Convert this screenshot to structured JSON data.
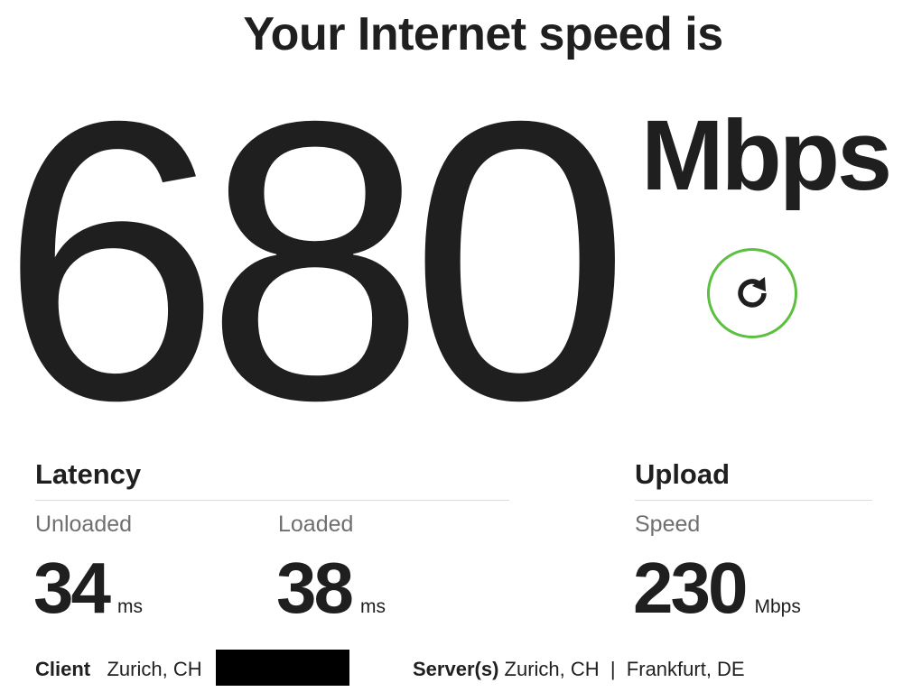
{
  "header": {
    "title": "Your Internet speed is"
  },
  "speed": {
    "value": "680",
    "unit": "Mbps"
  },
  "refresh": {
    "icon": "refresh-icon",
    "color": "#5cbf3f"
  },
  "latency": {
    "title": "Latency",
    "unloaded": {
      "label": "Unloaded",
      "value": "34",
      "unit": "ms"
    },
    "loaded": {
      "label": "Loaded",
      "value": "38",
      "unit": "ms"
    }
  },
  "upload": {
    "title": "Upload",
    "speed": {
      "label": "Speed",
      "value": "230",
      "unit": "Mbps"
    }
  },
  "footer": {
    "client_label": "Client",
    "client_value": "Zurich, CH",
    "server_label": "Server(s)",
    "server_value": "Zurich, CH  |  Frankfurt, DE"
  }
}
